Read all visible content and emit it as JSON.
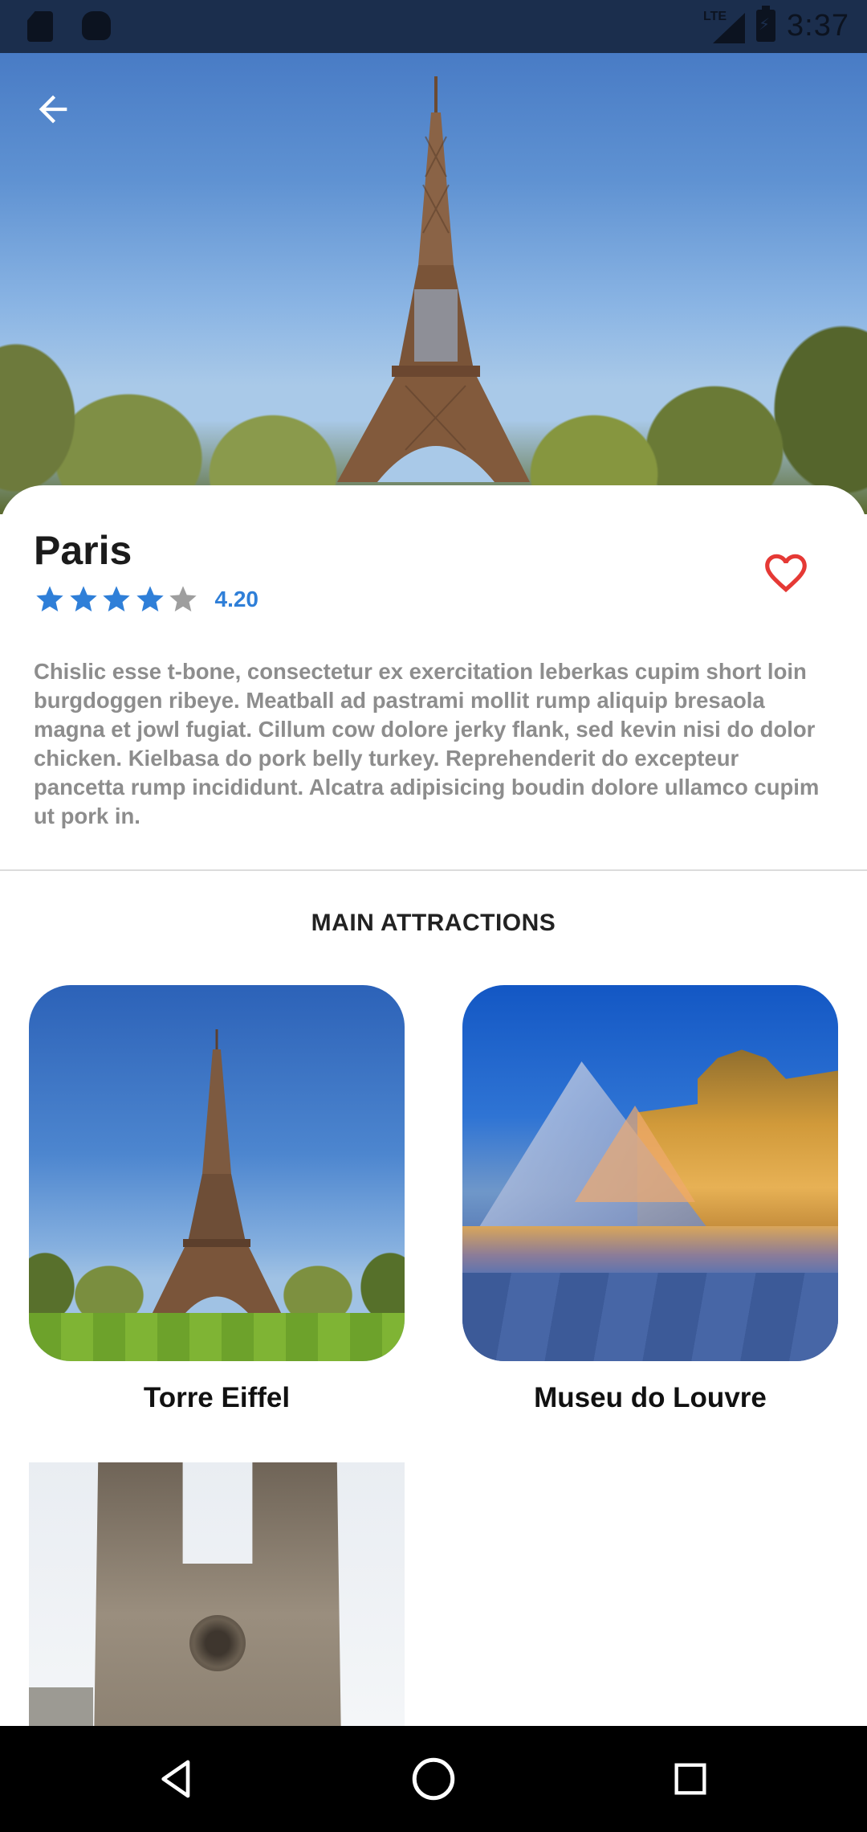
{
  "status_bar": {
    "time": "3:37",
    "network": "LTE",
    "icons": [
      "sd-card-icon",
      "android-debug-icon",
      "lte-signal-icon",
      "battery-charging-icon"
    ]
  },
  "destination": {
    "name": "Paris",
    "rating": 4.2,
    "rating_text": "4.20",
    "stars_total": 5,
    "description": "Chislic esse t-bone, consectetur ex exercitation leberkas cupim short loin burgdoggen ribeye. Meatball ad pastrami mollit rump aliquip bresaola magna et jowl fugiat. Cillum cow dolore jerky flank, sed kevin nisi do dolor chicken. Kielbasa do pork belly turkey. Reprehenderit do excepteur pancetta rump incididunt. Alcatra adipisicing boudin dolore ullamco cupim ut pork in.",
    "favorite": false
  },
  "attractions": {
    "title": "MAIN ATTRACTIONS",
    "items": [
      {
        "name": "Torre Eiffel"
      },
      {
        "name": "Museu do Louvre"
      },
      {
        "name": ""
      }
    ]
  },
  "colors": {
    "accent": "#2f7fd8",
    "heart": "#e53935",
    "star_empty": "#9e9e9e",
    "status_bar": "#1b2e4d"
  },
  "navigation": {
    "buttons": [
      "back-nav",
      "home-nav",
      "recents-nav"
    ]
  }
}
